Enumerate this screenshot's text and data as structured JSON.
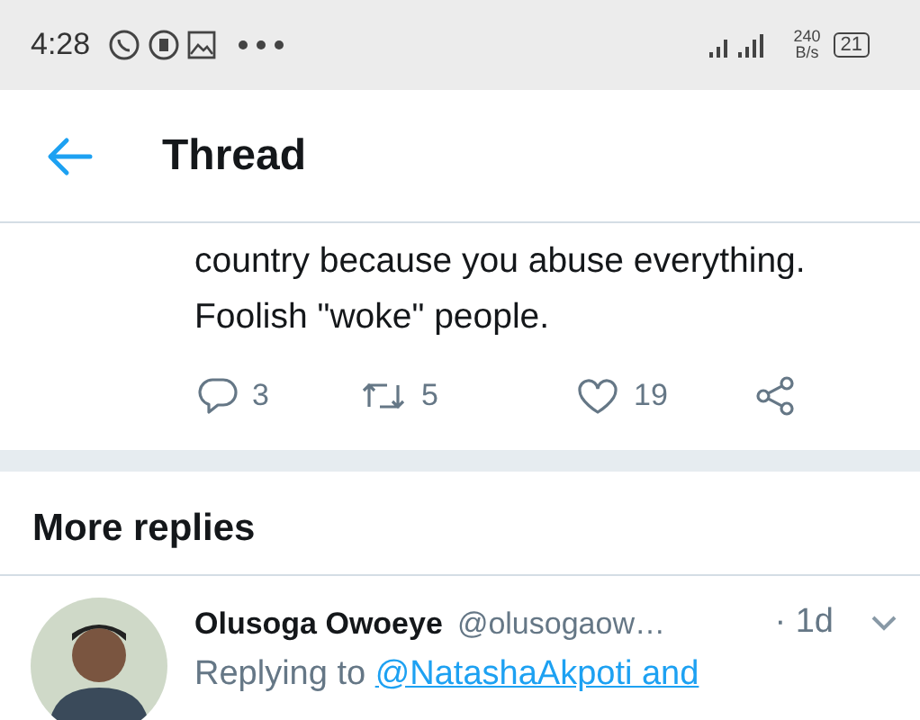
{
  "status_bar": {
    "time": "4:28",
    "speed_value": "240",
    "speed_unit": "B/s",
    "battery": "21"
  },
  "header": {
    "title": "Thread"
  },
  "tweet": {
    "lines": [
      "country because you abuse everything.",
      "Foolish \"woke\" people."
    ],
    "actions": [
      {
        "kind": "reply",
        "count": "3"
      },
      {
        "kind": "retweet",
        "count": "5"
      },
      {
        "kind": "like",
        "count": "19"
      },
      {
        "kind": "share"
      }
    ]
  },
  "more_replies": {
    "heading": "More replies"
  },
  "reply": {
    "name": "Olusoga Owoeye",
    "handle": "@olusogaow…",
    "time": "· 1d",
    "replying_prefix": "Replying to",
    "replying_link": "@NatashaAkpoti and"
  }
}
